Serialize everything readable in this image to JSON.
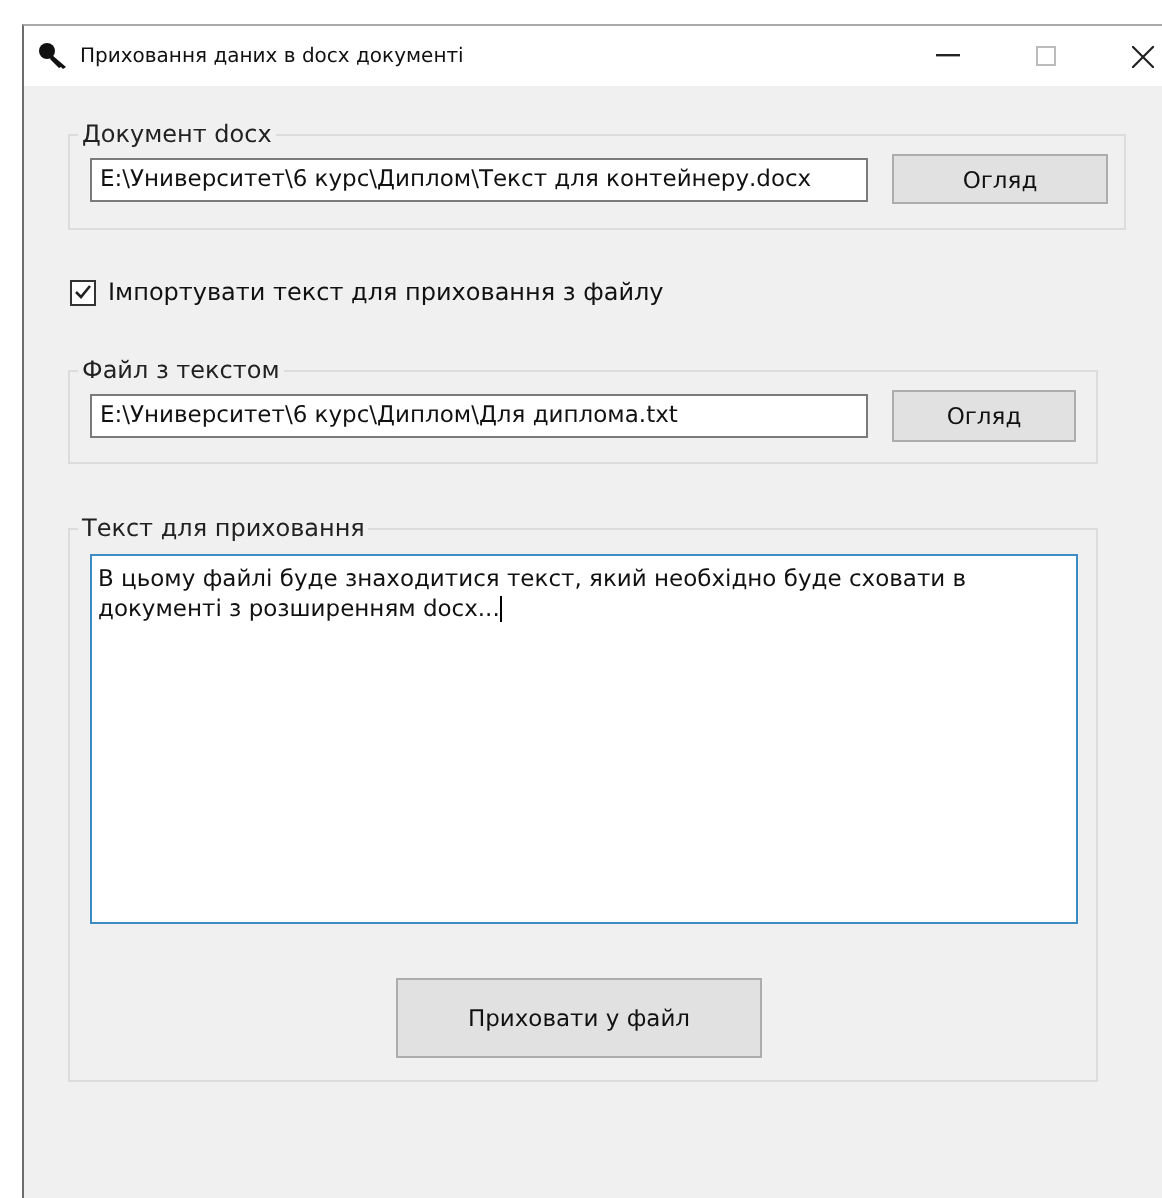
{
  "window": {
    "title": "Приховання даних в docx документі"
  },
  "document_group": {
    "legend": "Документ docx",
    "path": "E:\\Университет\\6 курс\\Диплом\\Текст для контейнеру.docx",
    "browse_button": "Огляд"
  },
  "import_checkbox": {
    "label": "Імпортувати текст для приховання з файлу",
    "checked": true
  },
  "text_file_group": {
    "legend": "Файл з текстом",
    "path": "E:\\Университет\\6 курс\\Диплом\\Для диплома.txt",
    "browse_button": "Огляд"
  },
  "hide_text_group": {
    "legend": "Текст для приховання",
    "text": "В цьому файлі буде знаходитися текст, який необхідно буде сховати в документі з розширенням docx...",
    "hide_button": "Приховати у файл"
  }
}
